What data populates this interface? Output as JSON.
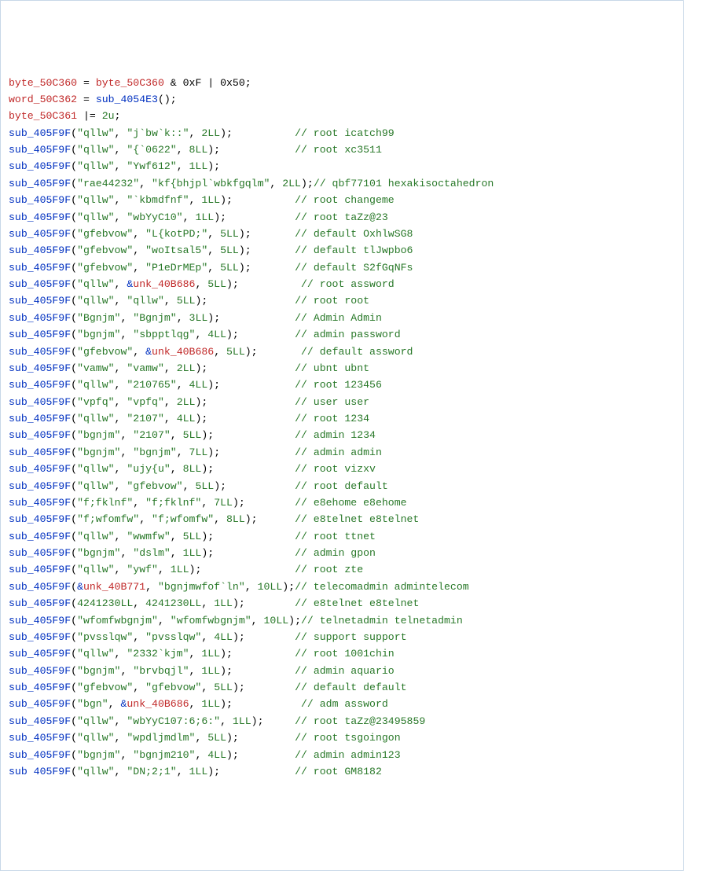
{
  "lines": [
    {
      "type": "assign3",
      "v": "byte_50C360",
      "rhs_ident": "byte_50C360",
      "rhs_tail": " & 0xF | 0x50;"
    },
    {
      "type": "assign_call",
      "v": "word_50C362",
      "fn": "sub_4054E3",
      "tail": "();"
    },
    {
      "type": "oreq",
      "v": "byte_50C361",
      "val": "2u"
    },
    {
      "type": "call2s",
      "fn": "sub_405F9F",
      "a": "qllw",
      "b": "j`bw`k::",
      "n": "2LL",
      "pad": 10,
      "c": "root icatch99"
    },
    {
      "type": "call2s",
      "fn": "sub_405F9F",
      "a": "qllw",
      "b": "{`0622",
      "n": "8LL",
      "pad": 12,
      "c": "root xc3511"
    },
    {
      "type": "call2s",
      "fn": "sub_405F9F",
      "a": "qllw",
      "b": "Ywf612",
      "n": "1LL",
      "pad": 0,
      "c": ""
    },
    {
      "type": "call2s",
      "fn": "sub_405F9F",
      "a": "rae44232",
      "b": "kf{bhjpl`wbkfgqlm",
      "n": "2LL",
      "pad": 0,
      "c": "qbf77101 hexakisoctahedron",
      "semi_nogap": true
    },
    {
      "type": "call2s",
      "fn": "sub_405F9F",
      "a": "qllw",
      "b": "`kbmdfnf",
      "n": "1LL",
      "pad": 10,
      "c": "root changeme"
    },
    {
      "type": "call2s",
      "fn": "sub_405F9F",
      "a": "qllw",
      "b": "wbYyC10",
      "n": "1LL",
      "pad": 11,
      "c": "root taZz@23"
    },
    {
      "type": "call2s",
      "fn": "sub_405F9F",
      "a": "gfebvow",
      "b": "L{kotPD;",
      "n": "5LL",
      "pad": 7,
      "c": "default OxhlwSG8"
    },
    {
      "type": "call2s",
      "fn": "sub_405F9F",
      "a": "gfebvow",
      "b": "woItsal5",
      "n": "5LL",
      "pad": 7,
      "c": "default tlJwpbo6"
    },
    {
      "type": "call2s",
      "fn": "sub_405F9F",
      "a": "gfebvow",
      "b": "P1eDrMEp",
      "n": "5LL",
      "pad": 7,
      "c": "default S2fGqNFs"
    },
    {
      "type": "call_s_unk",
      "fn": "sub_405F9F",
      "a": "qllw",
      "unk": "unk_40B686",
      "n": "5LL",
      "pad": 10,
      "c": "root assword"
    },
    {
      "type": "call2s",
      "fn": "sub_405F9F",
      "a": "qllw",
      "b": "qllw",
      "n": "5LL",
      "pad": 14,
      "c": "root root"
    },
    {
      "type": "call2s",
      "fn": "sub_405F9F",
      "a": "Bgnjm",
      "b": "Bgnjm",
      "n": "3LL",
      "pad": 12,
      "c": "Admin Admin"
    },
    {
      "type": "call2s",
      "fn": "sub_405F9F",
      "a": "bgnjm",
      "b": "sbpptlqg",
      "n": "4LL",
      "pad": 9,
      "c": "admin password"
    },
    {
      "type": "call_s_unk",
      "fn": "sub_405F9F",
      "a": "gfebvow",
      "unk": "unk_40B686",
      "n": "5LL",
      "pad": 7,
      "c": "default assword"
    },
    {
      "type": "call2s",
      "fn": "sub_405F9F",
      "a": "vamw",
      "b": "vamw",
      "n": "2LL",
      "pad": 14,
      "c": "ubnt ubnt"
    },
    {
      "type": "call2s",
      "fn": "sub_405F9F",
      "a": "qllw",
      "b": "210765",
      "n": "4LL",
      "pad": 12,
      "c": "root 123456"
    },
    {
      "type": "call2s",
      "fn": "sub_405F9F",
      "a": "vpfq",
      "b": "vpfq",
      "n": "2LL",
      "pad": 14,
      "c": "user user"
    },
    {
      "type": "call2s",
      "fn": "sub_405F9F",
      "a": "qllw",
      "b": "2107",
      "n": "4LL",
      "pad": 14,
      "c": "root 1234"
    },
    {
      "type": "call2s",
      "fn": "sub_405F9F",
      "a": "bgnjm",
      "b": "2107",
      "n": "5LL",
      "pad": 13,
      "c": "admin 1234"
    },
    {
      "type": "call2s",
      "fn": "sub_405F9F",
      "a": "bgnjm",
      "b": "bgnjm",
      "n": "7LL",
      "pad": 12,
      "c": "admin admin"
    },
    {
      "type": "call2s",
      "fn": "sub_405F9F",
      "a": "qllw",
      "b": "ujy{u",
      "n": "8LL",
      "pad": 13,
      "c": "root vizxv"
    },
    {
      "type": "call2s",
      "fn": "sub_405F9F",
      "a": "qllw",
      "b": "gfebvow",
      "n": "5LL",
      "pad": 11,
      "c": "root default"
    },
    {
      "type": "call2s",
      "fn": "sub_405F9F",
      "a": "f;fklnf",
      "b": "f;fklnf",
      "n": "7LL",
      "pad": 8,
      "c": "e8ehome e8ehome"
    },
    {
      "type": "call2s",
      "fn": "sub_405F9F",
      "a": "f;wfomfw",
      "b": "f;wfomfw",
      "n": "8LL",
      "pad": 6,
      "c": "e8telnet e8telnet"
    },
    {
      "type": "call2s",
      "fn": "sub_405F9F",
      "a": "qllw",
      "b": "wwmfw",
      "n": "5LL",
      "pad": 13,
      "c": "root ttnet"
    },
    {
      "type": "call2s",
      "fn": "sub_405F9F",
      "a": "bgnjm",
      "b": "dslm",
      "n": "1LL",
      "pad": 13,
      "c": "admin gpon"
    },
    {
      "type": "call2s",
      "fn": "sub_405F9F",
      "a": "qllw",
      "b": "ywf",
      "n": "1LL",
      "pad": 15,
      "c": "root zte"
    },
    {
      "type": "call_unk_s",
      "fn": "sub_405F9F",
      "unk": "unk_40B771",
      "b": "bgnjmwfof`ln",
      "n": "10LL",
      "pad": 0,
      "c": "telecomadmin admintelecom",
      "semi_nogap": true
    },
    {
      "type": "call_nn",
      "fn": "sub_405F9F",
      "a": "4241230LL",
      "b": "4241230LL",
      "n": "1LL",
      "pad": 8,
      "c": "e8telnet e8telnet"
    },
    {
      "type": "call2s",
      "fn": "sub_405F9F",
      "a": "wfomfwbgnjm",
      "b": "wfomfwbgnjm",
      "n": "10LL",
      "pad": 0,
      "c": "telnetadmin telnetadmin",
      "semi_nogap": true
    },
    {
      "type": "call2s",
      "fn": "sub_405F9F",
      "a": "pvsslqw",
      "b": "pvsslqw",
      "n": "4LL",
      "pad": 8,
      "c": "support support"
    },
    {
      "type": "call2s",
      "fn": "sub_405F9F",
      "a": "qllw",
      "b": "2332`kjm",
      "n": "1LL",
      "pad": 10,
      "c": "root 1001chin"
    },
    {
      "type": "call2s",
      "fn": "sub_405F9F",
      "a": "bgnjm",
      "b": "brvbqjl",
      "n": "1LL",
      "pad": 10,
      "c": "admin aquario"
    },
    {
      "type": "call2s",
      "fn": "sub_405F9F",
      "a": "gfebvow",
      "b": "gfebvow",
      "n": "5LL",
      "pad": 8,
      "c": "default default"
    },
    {
      "type": "call_s_unk",
      "fn": "sub_405F9F",
      "a": "bgn",
      "unk": "unk_40B686",
      "n": "1LL",
      "pad": 11,
      "c": "adm assword"
    },
    {
      "type": "call2s",
      "fn": "sub_405F9F",
      "a": "qllw",
      "b": "wbYyC107:6;6:",
      "n": "1LL",
      "pad": 5,
      "c": "root taZz@23495859"
    },
    {
      "type": "call2s",
      "fn": "sub_405F9F",
      "a": "qllw",
      "b": "wpdljmdlm",
      "n": "5LL",
      "pad": 9,
      "c": "root tsgoingon"
    },
    {
      "type": "call2s",
      "fn": "sub_405F9F",
      "a": "bgnjm",
      "b": "bgnjm210",
      "n": "4LL",
      "pad": 9,
      "c": "admin admin123"
    },
    {
      "type": "callspace",
      "fn": "sub 405F9F",
      "a": "qllw",
      "b": "DN;2;1",
      "n": "1LL",
      "pad": 12,
      "c": "root GM8182"
    }
  ]
}
